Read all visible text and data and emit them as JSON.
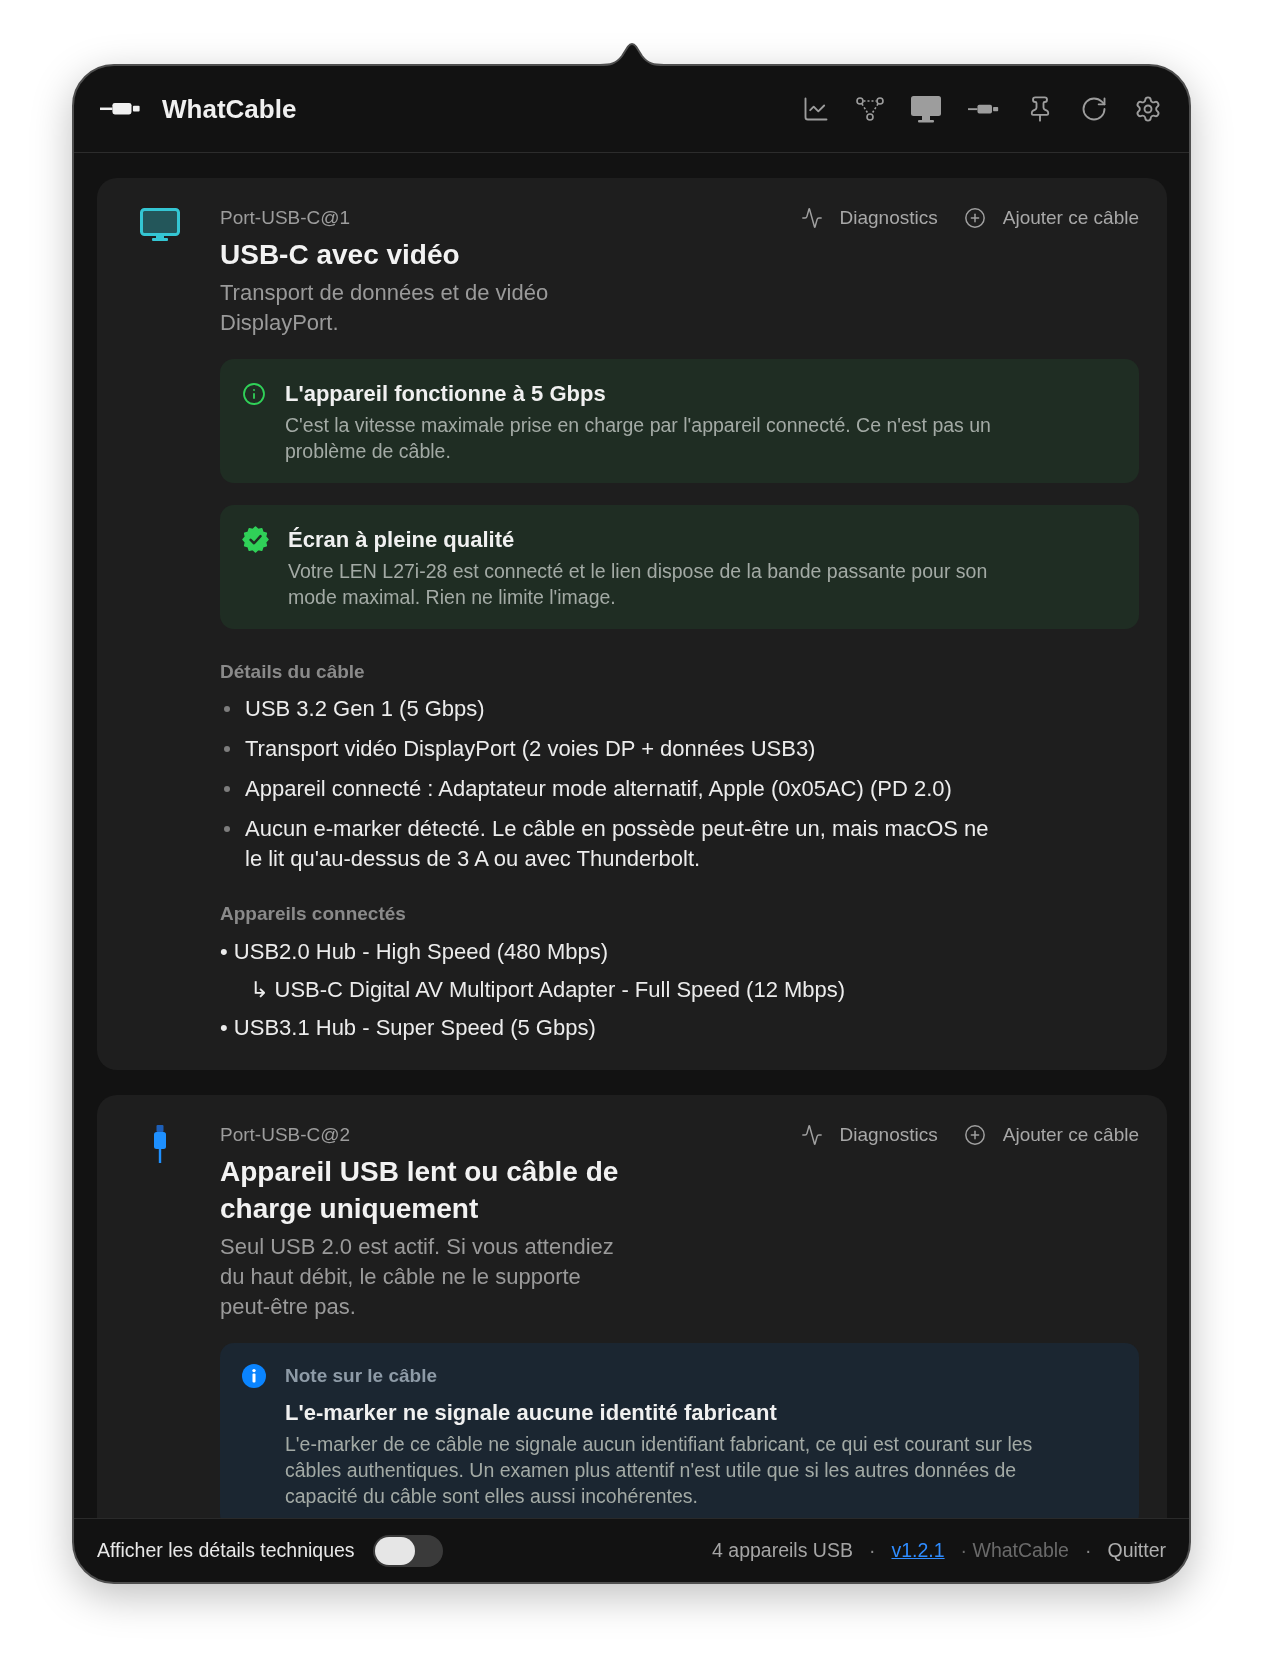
{
  "window": {
    "title": "WhatCable"
  },
  "ports": [
    {
      "kind": "video",
      "port": "Port-USB-C@1",
      "title": "USB-C avec vidéo",
      "summary": "Transport de données et de vidéo DisplayPort.",
      "actions": [
        {
          "kind": "diagnostics",
          "label": "Diagnostics"
        },
        {
          "kind": "add",
          "label": "Ajouter ce câble"
        }
      ],
      "callouts": [
        {
          "kind": "info",
          "title": "L'appareil fonctionne à 5 Gbps",
          "body": "C'est la vitesse maximale prise en charge par l'appareil connecté. Ce n'est pas un problème de câble."
        },
        {
          "kind": "success",
          "title": "Écran à pleine qualité",
          "body": "Votre LEN L27i-28 est connecté et le lien dispose de la bande passante pour son mode maximal. Rien ne limite l'image."
        }
      ],
      "sections": [
        {
          "kind": "bullets",
          "heading": "Détails du câble",
          "items": [
            "USB 3.2 Gen 1 (5 Gbps)",
            "Transport vidéo DisplayPort (2 voies DP + données USB3)",
            "Appareil connecté : Adaptateur mode alternatif, Apple (0x05AC) (PD 2.0)",
            "Aucun e-marker détecté. Le câble en possède peut-être un, mais macOS ne le lit qu'au-dessus de 3 A ou avec Thunderbolt."
          ]
        },
        {
          "kind": "tree",
          "heading": "Appareils connectés",
          "items": [
            {
              "text": "• USB2.0 Hub - High Speed (480 Mbps)",
              "children": [
                {
                  "text": "↳ USB-C Digital AV Multiport Adapter - Full Speed (12 Mbps)"
                }
              ]
            },
            {
              "text": "• USB3.1 Hub - Super Speed (5 Gbps)"
            }
          ]
        }
      ]
    },
    {
      "kind": "usb",
      "port": "Port-USB-C@2",
      "title": "Appareil USB lent ou câble de charge uniquement",
      "summary": "Seul USB 2.0 est actif. Si vous attendiez du haut débit, le câble ne le supporte peut-être pas.",
      "actions": [
        {
          "kind": "diagnostics",
          "label": "Diagnostics"
        },
        {
          "kind": "add",
          "label": "Ajouter ce câble"
        }
      ],
      "callouts": [
        {
          "kind": "note",
          "label": "Note sur le câble",
          "title": "L'e-marker ne signale aucune identité fabricant",
          "body": "L'e-marker de ce câble ne signale aucun identifiant fabricant, ce qui est courant sur les câbles authentiques. Un examen plus attentif n'est utile que si les autres données de capacité du câble sont elles aussi incohérentes."
        }
      ]
    }
  ],
  "footer": {
    "toggle": {
      "label": "Afficher les détails techniques",
      "on": false
    },
    "items": [
      {
        "kind": "count",
        "text": "4 appareils USB"
      },
      {
        "kind": "separator",
        "text": "·"
      },
      {
        "kind": "link",
        "text": "v1.2.1"
      },
      {
        "kind": "brand",
        "text": "· WhatCable"
      },
      {
        "kind": "separator",
        "text": "·"
      },
      {
        "kind": "button",
        "text": "Quitter"
      }
    ]
  }
}
